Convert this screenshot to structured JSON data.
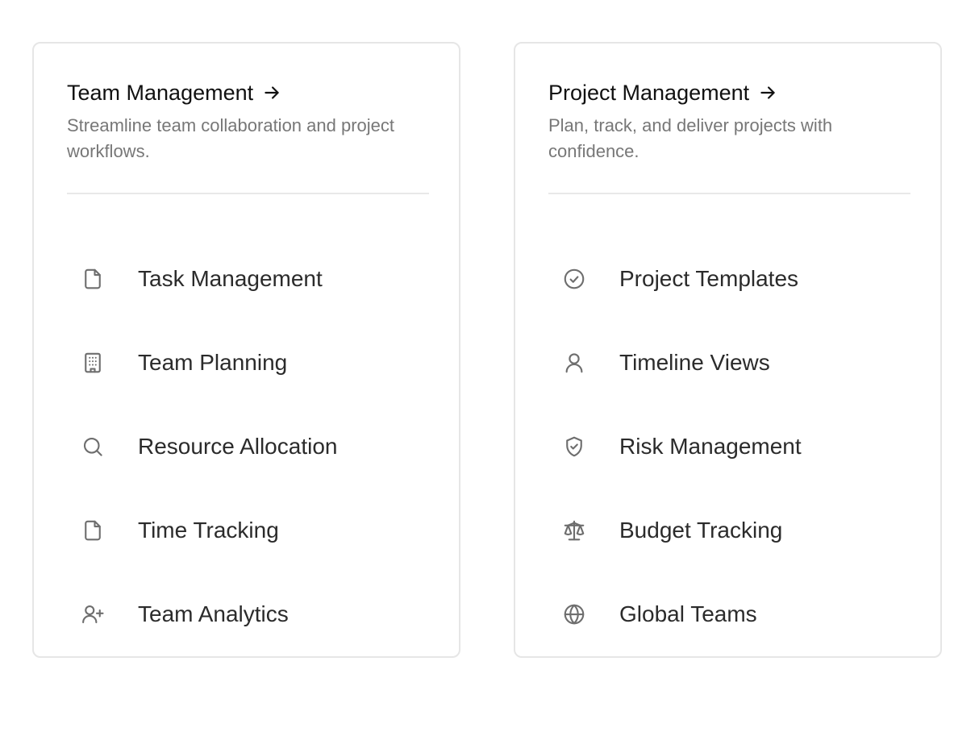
{
  "cards": [
    {
      "title": "Team Management",
      "description": "Streamline team collaboration and project workflows.",
      "items": [
        {
          "label": "Task Management",
          "icon": "file-icon"
        },
        {
          "label": "Team Planning",
          "icon": "building-icon"
        },
        {
          "label": "Resource Allocation",
          "icon": "search-icon"
        },
        {
          "label": "Time Tracking",
          "icon": "file-icon"
        },
        {
          "label": "Team Analytics",
          "icon": "user-plus-icon"
        }
      ]
    },
    {
      "title": "Project Management",
      "description": "Plan, track, and deliver projects with confidence.",
      "items": [
        {
          "label": "Project Templates",
          "icon": "check-circle-icon"
        },
        {
          "label": "Timeline Views",
          "icon": "user-icon"
        },
        {
          "label": "Risk Management",
          "icon": "shield-check-icon"
        },
        {
          "label": "Budget Tracking",
          "icon": "scale-icon"
        },
        {
          "label": "Global Teams",
          "icon": "globe-icon"
        }
      ]
    }
  ],
  "colors": {
    "title": "#111111",
    "description": "#777777",
    "item_label": "#2b2b2b",
    "icon": "#6e6e6e",
    "border": "#e6e6e6"
  }
}
